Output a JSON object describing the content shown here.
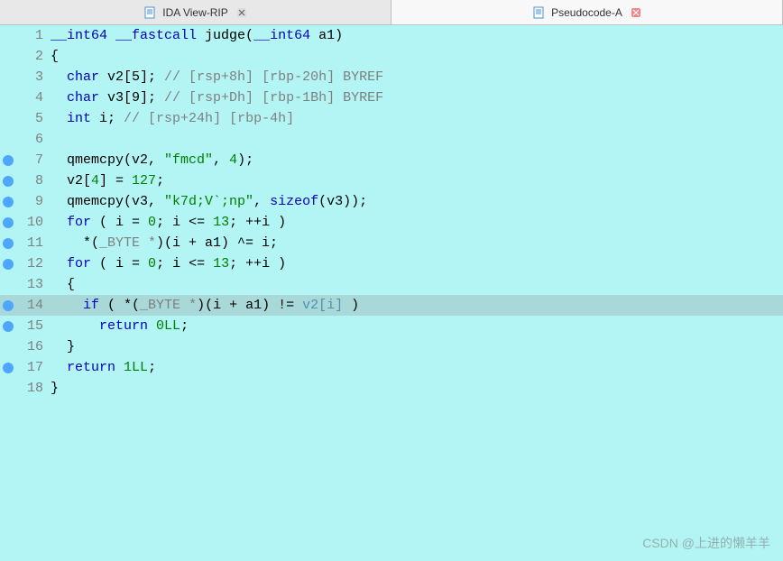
{
  "tabs": [
    {
      "label": "IDA View-RIP",
      "active": false
    },
    {
      "label": "Pseudocode-A",
      "active": true
    }
  ],
  "watermark": "CSDN @上进的懒羊羊",
  "code": {
    "lines": [
      {
        "n": 1,
        "bp": false,
        "hl": false,
        "tokens": [
          [
            "type",
            "__int64 __fastcall "
          ],
          [
            "ident",
            "judge"
          ],
          [
            "ident",
            "("
          ],
          [
            "type",
            "__int64 "
          ],
          [
            "ident",
            "a1)"
          ]
        ]
      },
      {
        "n": 2,
        "bp": false,
        "hl": false,
        "tokens": [
          [
            "ident",
            "{"
          ]
        ]
      },
      {
        "n": 3,
        "bp": false,
        "hl": false,
        "tokens": [
          [
            "ident",
            "  "
          ],
          [
            "type",
            "char "
          ],
          [
            "ident",
            "v2[5]; "
          ],
          [
            "comment",
            "// [rsp+8h] [rbp-20h] BYREF"
          ]
        ]
      },
      {
        "n": 4,
        "bp": false,
        "hl": false,
        "tokens": [
          [
            "ident",
            "  "
          ],
          [
            "type",
            "char "
          ],
          [
            "ident",
            "v3[9]; "
          ],
          [
            "comment",
            "// [rsp+Dh] [rbp-1Bh] BYREF"
          ]
        ]
      },
      {
        "n": 5,
        "bp": false,
        "hl": false,
        "tokens": [
          [
            "ident",
            "  "
          ],
          [
            "type",
            "int "
          ],
          [
            "ident",
            "i; "
          ],
          [
            "comment",
            "// [rsp+24h] [rbp-4h]"
          ]
        ]
      },
      {
        "n": 6,
        "bp": false,
        "hl": false,
        "tokens": []
      },
      {
        "n": 7,
        "bp": true,
        "hl": false,
        "tokens": [
          [
            "ident",
            "  "
          ],
          [
            "func",
            "qmemcpy"
          ],
          [
            "ident",
            "(v2, "
          ],
          [
            "str",
            "\"fmcd\""
          ],
          [
            "ident",
            ", "
          ],
          [
            "num",
            "4"
          ],
          [
            "ident",
            ");"
          ]
        ]
      },
      {
        "n": 8,
        "bp": true,
        "hl": false,
        "tokens": [
          [
            "ident",
            "  v2["
          ],
          [
            "num",
            "4"
          ],
          [
            "ident",
            "] = "
          ],
          [
            "num",
            "127"
          ],
          [
            "ident",
            ";"
          ]
        ]
      },
      {
        "n": 9,
        "bp": true,
        "hl": false,
        "tokens": [
          [
            "ident",
            "  "
          ],
          [
            "func",
            "qmemcpy"
          ],
          [
            "ident",
            "(v3, "
          ],
          [
            "str",
            "\"k7d;V`;np\""
          ],
          [
            "ident",
            ", "
          ],
          [
            "kw",
            "sizeof"
          ],
          [
            "ident",
            "(v3));"
          ]
        ]
      },
      {
        "n": 10,
        "bp": true,
        "hl": false,
        "tokens": [
          [
            "ident",
            "  "
          ],
          [
            "kw",
            "for"
          ],
          [
            "ident",
            " ( i = "
          ],
          [
            "num",
            "0"
          ],
          [
            "ident",
            "; i <= "
          ],
          [
            "num",
            "13"
          ],
          [
            "ident",
            "; ++i )"
          ]
        ]
      },
      {
        "n": 11,
        "bp": true,
        "hl": false,
        "tokens": [
          [
            "ident",
            "    *("
          ],
          [
            "cast",
            "_BYTE *"
          ],
          [
            "ident",
            ")(i + a1) ^= i;"
          ]
        ]
      },
      {
        "n": 12,
        "bp": true,
        "hl": false,
        "tokens": [
          [
            "ident",
            "  "
          ],
          [
            "kw",
            "for"
          ],
          [
            "ident",
            " ( i = "
          ],
          [
            "num",
            "0"
          ],
          [
            "ident",
            "; i <= "
          ],
          [
            "num",
            "13"
          ],
          [
            "ident",
            "; ++i )"
          ]
        ]
      },
      {
        "n": 13,
        "bp": false,
        "hl": false,
        "tokens": [
          [
            "ident",
            "  {"
          ]
        ]
      },
      {
        "n": 14,
        "bp": true,
        "hl": true,
        "tokens": [
          [
            "ident",
            "    "
          ],
          [
            "kw",
            "if"
          ],
          [
            "ident",
            " ( *("
          ],
          [
            "cast",
            "_BYTE *"
          ],
          [
            "ident",
            ")(i + a1) != "
          ],
          [
            "var",
            "v2[i]"
          ],
          [
            "ident",
            " )"
          ]
        ]
      },
      {
        "n": 15,
        "bp": true,
        "hl": false,
        "tokens": [
          [
            "ident",
            "      "
          ],
          [
            "kw",
            "return"
          ],
          [
            "ident",
            " "
          ],
          [
            "num",
            "0LL"
          ],
          [
            "ident",
            ";"
          ]
        ]
      },
      {
        "n": 16,
        "bp": false,
        "hl": false,
        "tokens": [
          [
            "ident",
            "  }"
          ]
        ]
      },
      {
        "n": 17,
        "bp": true,
        "hl": false,
        "tokens": [
          [
            "ident",
            "  "
          ],
          [
            "kw",
            "return"
          ],
          [
            "ident",
            " "
          ],
          [
            "num",
            "1LL"
          ],
          [
            "ident",
            ";"
          ]
        ]
      },
      {
        "n": 18,
        "bp": false,
        "hl": false,
        "tokens": [
          [
            "ident",
            "}"
          ]
        ]
      }
    ]
  }
}
